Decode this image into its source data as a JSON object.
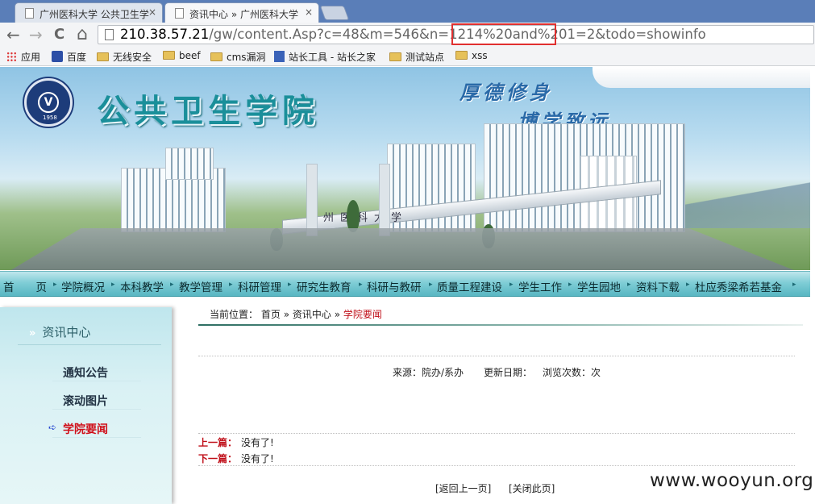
{
  "tabs": [
    {
      "title": "广州医科大学 公共卫生学",
      "close": "×"
    },
    {
      "title": "资讯中心 » 广州医科大学",
      "close": "×"
    }
  ],
  "toolbar": {
    "back": "←",
    "forward": "→",
    "reload": "C",
    "home": "⌂",
    "url_host": "210.38.57.21",
    "url_path": "/gw/content.Asp?c=48&m=546&n=1214%20and%201=2&todo=showinfo"
  },
  "bookmarks": [
    {
      "label": "应用",
      "icon": "apps-grid-icon"
    },
    {
      "label": "百度",
      "icon": "baidu-paw-icon"
    },
    {
      "label": "无线安全",
      "icon": "folder-icon"
    },
    {
      "label": "beef",
      "icon": "folder-icon"
    },
    {
      "label": "cms漏洞",
      "icon": "folder-icon"
    },
    {
      "label": "站长工具 - 站长之家",
      "icon": "site-icon"
    },
    {
      "label": "测试站点",
      "icon": "folder-icon"
    },
    {
      "label": "xss",
      "icon": "folder-icon"
    }
  ],
  "banner": {
    "title": "公共卫生学院",
    "slogan1": "厚德修身",
    "slogan2": "博学致远",
    "building_name": "广州医科大学",
    "logo_year": "1958"
  },
  "nav": [
    "首　　页",
    "学院概况",
    "本科教学",
    "教学管理",
    "科研管理",
    "研究生教育",
    "科研与教研",
    "质量工程建设",
    "学生工作",
    "学生园地",
    "资料下载",
    "杜应秀梁希若基金"
  ],
  "nav_sep": "▸",
  "sidebar": {
    "heading_arrow": "»",
    "heading": "资讯中心",
    "items": [
      {
        "label": "通知公告",
        "active": false
      },
      {
        "label": "滚动图片",
        "active": false
      },
      {
        "label": "学院要闻",
        "active": true
      }
    ]
  },
  "breadcrumb": {
    "prefix": "当前位置：",
    "home": "首页",
    "sep": "»",
    "section": "资讯中心",
    "current": "学院要闻"
  },
  "article": {
    "source": "来源：院办/系办",
    "updated": "更新日期：",
    "views": "浏览次数：次"
  },
  "prevnext": {
    "prev_label": "上一篇：",
    "prev_value": "没有了!",
    "next_label": "下一篇：",
    "next_value": "没有了!"
  },
  "actions": {
    "back": "[返回上一页]",
    "close": "[关闭此页]"
  },
  "watermark": "www.wooyun.org",
  "colors": {
    "highlight": "#e03030",
    "accent_red": "#c0101a",
    "nav_teal": "#58b6c2"
  }
}
